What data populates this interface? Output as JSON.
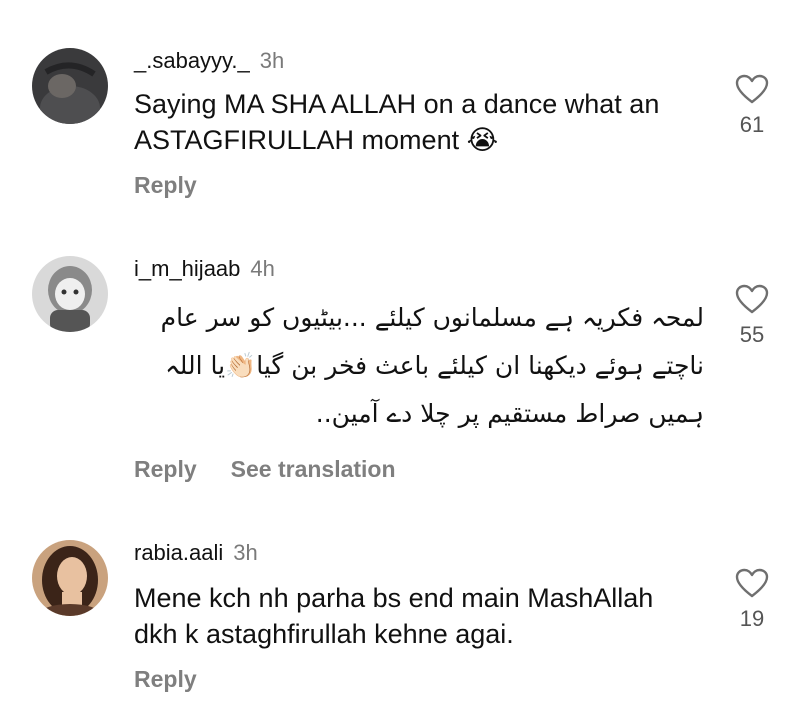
{
  "comments": [
    {
      "username": "_.sabayyy._",
      "time": "3h",
      "text": "Saying MA SHA ALLAH on a dance what an ASTAGFIRULLAH moment 😭",
      "reply_label": "Reply",
      "likes": "61",
      "icon": "heart-outline-icon"
    },
    {
      "username": "i_m_hijaab",
      "time": "4h",
      "text_lines": [
        "لمحہ فکریہ ہے مسلمانوں کیلئے ...بیٹیوں کو سر عام",
        "ناچتے ہوئے دیکھنا ان کیلئے باعث فخر بن گیا👏🏻یا اللہ",
        "ہمیں صراط مستقیم پر چلا دے آمین.."
      ],
      "reply_label": "Reply",
      "translate_label": "See translation",
      "likes": "55",
      "icon": "heart-outline-icon"
    },
    {
      "username": "rabia.aali",
      "time": "3h",
      "text": "Mene kch nh parha bs end main MashAllah dkh k astaghfirullah kehne agai.",
      "reply_label": "Reply",
      "likes": "19",
      "icon": "heart-outline-icon"
    }
  ]
}
